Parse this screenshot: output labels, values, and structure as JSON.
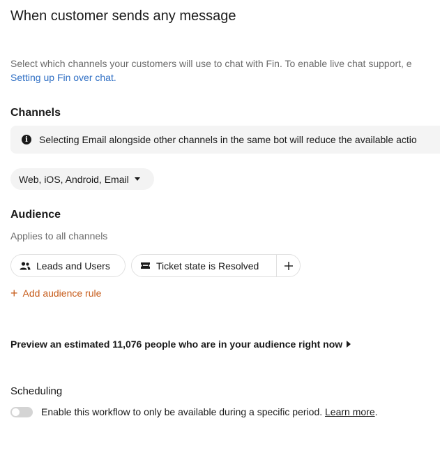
{
  "header": {
    "title": "When customer sends any message"
  },
  "intro": {
    "text": "Select which channels your customers will use to chat with Fin. To enable live chat support, e",
    "link": "Setting up Fin over chat."
  },
  "channels": {
    "heading": "Channels",
    "notice_icon": "info-icon",
    "notice": "Selecting Email alongside other channels in the same bot will reduce the available actio",
    "selected": "Web, iOS, Android, Email"
  },
  "audience": {
    "heading": "Audience",
    "subtext": "Applies to all channels",
    "chips": [
      {
        "icon": "people-icon",
        "label": "Leads and Users"
      },
      {
        "icon": "ticket-icon",
        "label_key": "Ticket state",
        "label_rest": " is Resolved"
      }
    ],
    "add_rule": "Add audience rule"
  },
  "preview": {
    "text": "Preview an estimated 11,076 people who are in your audience right now"
  },
  "scheduling": {
    "heading": "Scheduling",
    "toggle_on": false,
    "text": "Enable this workflow to only be available during a specific period. ",
    "learn_more": "Learn more",
    "suffix": "."
  },
  "colors": {
    "link": "#2f6fc4",
    "accent": "#c75d1c",
    "toggle_off": "#d4d4d4"
  }
}
